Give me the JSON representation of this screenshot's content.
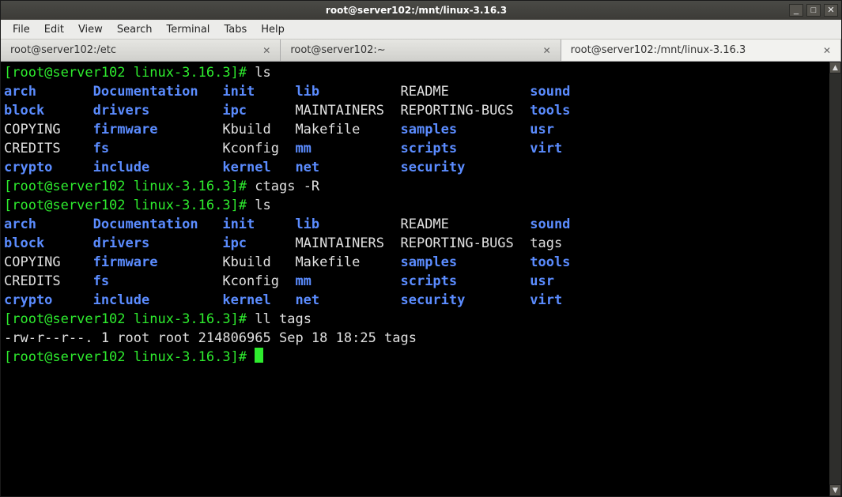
{
  "window": {
    "title": "root@server102:/mnt/linux-3.16.3"
  },
  "menu": {
    "file": "File",
    "edit": "Edit",
    "view": "View",
    "search": "Search",
    "terminal": "Terminal",
    "tabs": "Tabs",
    "help": "Help"
  },
  "tabs": [
    {
      "label": "root@server102:/etc"
    },
    {
      "label": "root@server102:~"
    },
    {
      "label": "root@server102:/mnt/linux-3.16.3",
      "active": true
    }
  ],
  "prompt": "[root@server102 linux-3.16.3]# ",
  "cmds": {
    "ls": "ls",
    "ctags": "ctags -R",
    "ll": "ll tags"
  },
  "ls1": {
    "r0": {
      "c1": "arch",
      "c2": "Documentation",
      "c3": "init",
      "c4": "lib",
      "c5": "README",
      "c6": "sound"
    },
    "r1": {
      "c1": "block",
      "c2": "drivers",
      "c3": "ipc",
      "c4": "MAINTAINERS",
      "c5": "REPORTING-BUGS",
      "c6": "tools"
    },
    "r2": {
      "c1": "COPYING",
      "c2": "firmware",
      "c3": "Kbuild",
      "c4": "Makefile",
      "c5": "samples",
      "c6": "usr"
    },
    "r3": {
      "c1": "CREDITS",
      "c2": "fs",
      "c3": "Kconfig",
      "c4": "mm",
      "c5": "scripts",
      "c6": "virt"
    },
    "r4": {
      "c1": "crypto",
      "c2": "include",
      "c3": "kernel",
      "c4": "net",
      "c5": "security",
      "c6": ""
    }
  },
  "ls1_types": {
    "r0": [
      "d",
      "d",
      "d",
      "d",
      "f",
      "d"
    ],
    "r1": [
      "d",
      "d",
      "d",
      "f",
      "f",
      "d"
    ],
    "r2": [
      "f",
      "d",
      "f",
      "f",
      "d",
      "d"
    ],
    "r3": [
      "f",
      "d",
      "f",
      "d",
      "d",
      "d"
    ],
    "r4": [
      "d",
      "d",
      "d",
      "d",
      "d",
      ""
    ]
  },
  "ls2": {
    "r0": {
      "c1": "arch",
      "c2": "Documentation",
      "c3": "init",
      "c4": "lib",
      "c5": "README",
      "c6": "sound"
    },
    "r1": {
      "c1": "block",
      "c2": "drivers",
      "c3": "ipc",
      "c4": "MAINTAINERS",
      "c5": "REPORTING-BUGS",
      "c6": "tags"
    },
    "r2": {
      "c1": "COPYING",
      "c2": "firmware",
      "c3": "Kbuild",
      "c4": "Makefile",
      "c5": "samples",
      "c6": "tools"
    },
    "r3": {
      "c1": "CREDITS",
      "c2": "fs",
      "c3": "Kconfig",
      "c4": "mm",
      "c5": "scripts",
      "c6": "usr"
    },
    "r4": {
      "c1": "crypto",
      "c2": "include",
      "c3": "kernel",
      "c4": "net",
      "c5": "security",
      "c6": "virt"
    }
  },
  "ls2_types": {
    "r0": [
      "d",
      "d",
      "d",
      "d",
      "f",
      "d"
    ],
    "r1": [
      "d",
      "d",
      "d",
      "f",
      "f",
      "f"
    ],
    "r2": [
      "f",
      "d",
      "f",
      "f",
      "d",
      "d"
    ],
    "r3": [
      "f",
      "d",
      "f",
      "d",
      "d",
      "d"
    ],
    "r4": [
      "d",
      "d",
      "d",
      "d",
      "d",
      "d"
    ]
  },
  "ll_output": "-rw-r--r--. 1 root root 214806965 Sep 18 18:25 tags"
}
